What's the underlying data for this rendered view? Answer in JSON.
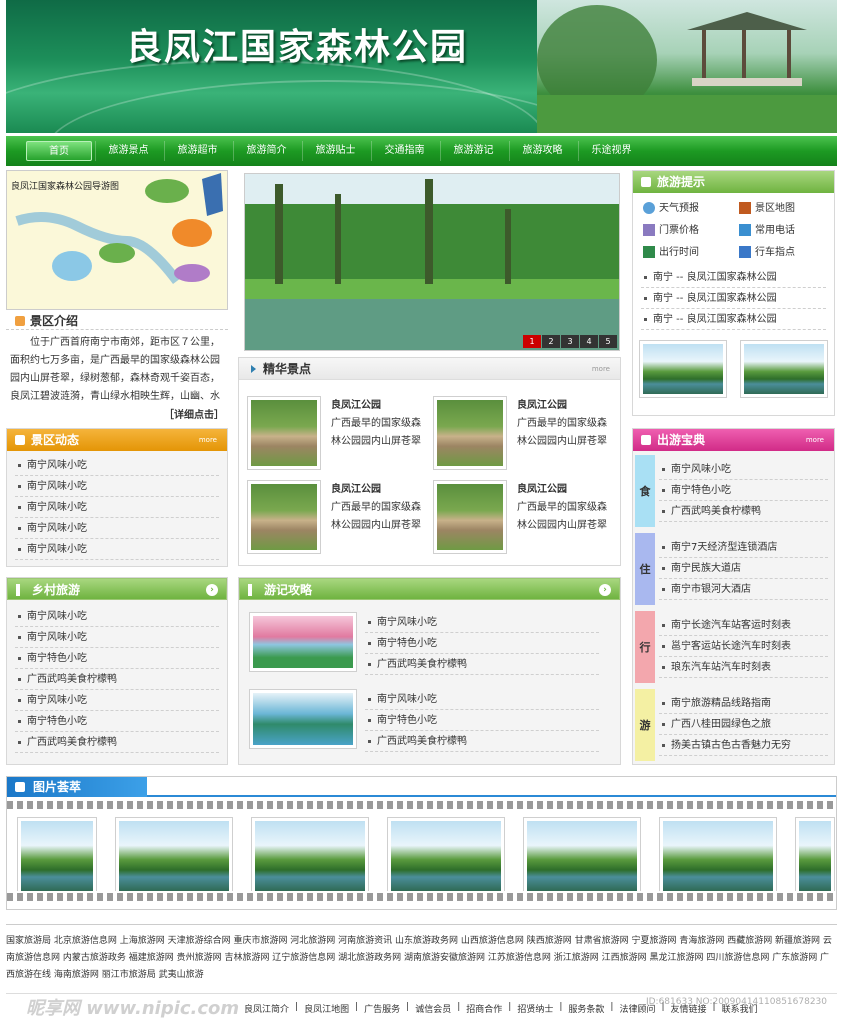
{
  "header": {
    "title": "良凤江国家森林公园"
  },
  "nav": {
    "items": [
      "首页",
      "旅游景点",
      "旅游超市",
      "旅游简介",
      "旅游贴士",
      "交通指南",
      "旅游游记",
      "旅游攻略",
      "乐途视界"
    ]
  },
  "map": {
    "title": "良凤江国家森林公园导游图"
  },
  "intro": {
    "title": "景区介绍",
    "text": "位于广西首府南宁市南郊，距市区７公里，面积约七万多亩，是广西最早的国家级森林公园园内山屏苍翠，绿树葱郁，森林奇观千姿百态，良凤江碧波涟漪，青山绿水相映生辉，山幽、水碧、树奇、气",
    "more": "［详细点击］"
  },
  "slideshow": {
    "pages": [
      "1",
      "2",
      "3",
      "4",
      "5"
    ]
  },
  "tips": {
    "title": "旅游提示",
    "links": [
      "天气预报",
      "景区地图",
      "门票价格",
      "常用电话",
      "出行时间",
      "行车指点"
    ],
    "items": [
      "南宁 -- 良凤江国家森林公园",
      "南宁 -- 良凤江国家森林公园",
      "南宁 -- 良凤江国家森林公园"
    ]
  },
  "featured": {
    "title": "精华景点",
    "more": "more",
    "items": [
      {
        "name": "良凤江公园",
        "desc": "广西最早的国家级森林公园园内山屏苍翠"
      },
      {
        "name": "良凤江公园",
        "desc": "广西最早的国家级森林公园园内山屏苍翠"
      },
      {
        "name": "良凤江公园",
        "desc": "广西最早的国家级森林公园园内山屏苍翠"
      },
      {
        "name": "良凤江公园",
        "desc": "广西最早的国家级森林公园园内山屏苍翠"
      }
    ]
  },
  "news": {
    "title": "景区动态",
    "more": "more",
    "items": [
      "南宁风味小吃",
      "南宁风味小吃",
      "南宁风味小吃",
      "南宁风味小吃",
      "南宁风味小吃"
    ]
  },
  "rural": {
    "title": "乡村旅游",
    "items": [
      "南宁风味小吃",
      "南宁风味小吃",
      "南宁特色小吃",
      "广西武鸣美食柠檬鸭",
      "南宁风味小吃",
      "南宁特色小吃",
      "广西武鸣美食柠檬鸭"
    ]
  },
  "travelogue": {
    "title": "游记攻略",
    "groups": [
      [
        "南宁风味小吃",
        "南宁特色小吃",
        "广西武鸣美食柠檬鸭"
      ],
      [
        "南宁风味小吃",
        "南宁特色小吃",
        "广西武鸣美食柠檬鸭"
      ]
    ]
  },
  "guide": {
    "title": "出游宝典",
    "more": "more",
    "sections": [
      {
        "label": "食",
        "color": "#a9e0f4",
        "items": [
          "南宁风味小吃",
          "南宁特色小吃",
          "广西武鸣美食柠檬鸭"
        ]
      },
      {
        "label": "住",
        "color": "#a9b8ef",
        "items": [
          "南宁7天经济型连锁酒店",
          "南宁民族大道店",
          "南宁市银河大酒店"
        ]
      },
      {
        "label": "行",
        "color": "#f3a7ad",
        "items": [
          "南宁长途汽车站客运时刻表",
          "邕宁客运站长途汽车时刻表",
          "琅东汽车站汽车时刻表"
        ]
      },
      {
        "label": "游",
        "color": "#f4f0a3",
        "items": [
          "南宁旅游精品线路指南",
          "广西八桂田园绿色之旅",
          "扬美古镇古色古香魅力无穷"
        ]
      }
    ]
  },
  "gallery": {
    "title": "图片荟萃"
  },
  "links": {
    "text": "国家旅游局  北京旅游信息网  上海旅游网  天津旅游综合网  重庆市旅游网  河北旅游网  河南旅游资讯  山东旅游政务网  山西旅游信息网  陕西旅游网  甘肃省旅游网  宁夏旅游网  青海旅游网  西藏旅游网  新疆旅游网  云南旅游信息网  内蒙古旅游政务  福建旅游网  贵州旅游网  吉林旅游网  辽宁旅游信息网  湖北旅游政务网  湖南旅游安徽旅游网  江苏旅游信息网  浙江旅游网  江西旅游网  黑龙江旅游网  四川旅游信息网  广东旅游网  广西旅游在线  海南旅游网  丽江市旅游局  武夷山旅游"
  },
  "footer": {
    "links": [
      "良凤江简介",
      "良凤江地图",
      "广告服务",
      "诚信会员",
      "招商合作",
      "招贤纳士",
      "服务条款",
      "法律顾问",
      "友情链接",
      "联系我们"
    ],
    "watermark": "昵享网 www.nipic.com",
    "id_text": "ID:681633 NO:20090414110851678230"
  }
}
